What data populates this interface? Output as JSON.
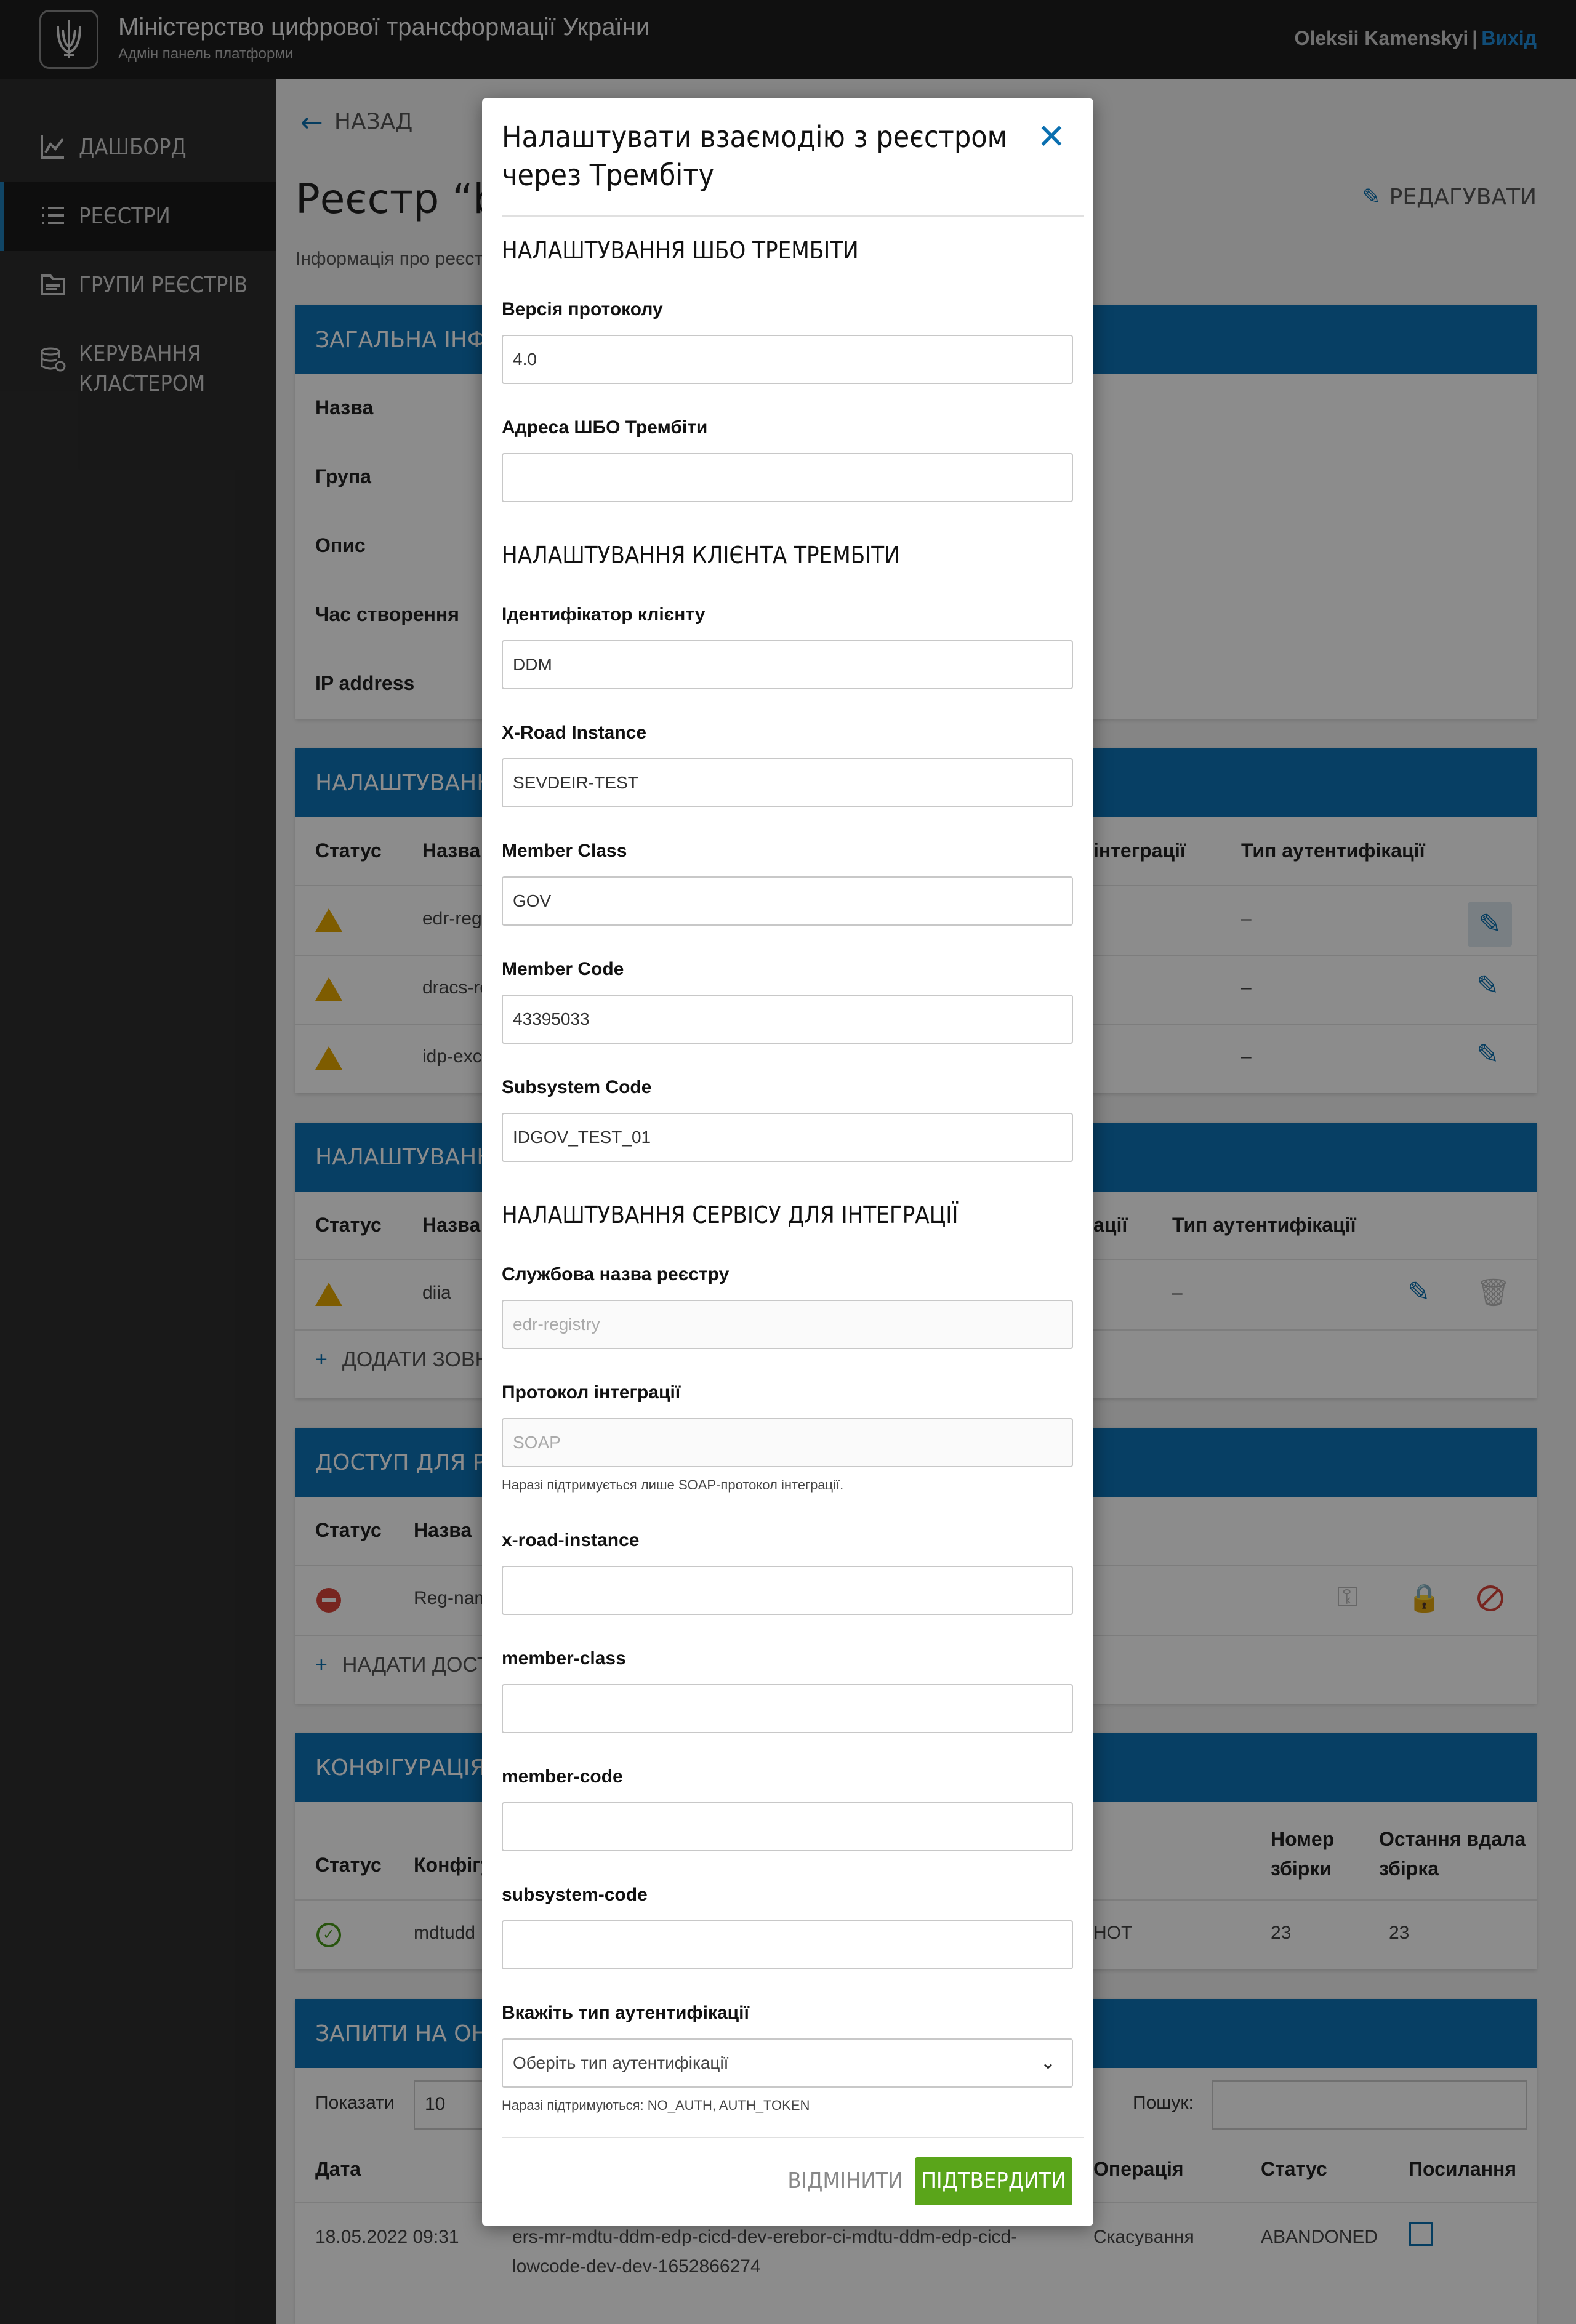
{
  "header": {
    "title": "Міністерство цифрової трансформації України",
    "subtitle": "Адмін панель платформи",
    "user_name": "Oleksii Kamenskyi",
    "separator": "|",
    "logout": "Вихід"
  },
  "sidebar": {
    "items": [
      {
        "label": "Дашборд",
        "icon": "chart-icon"
      },
      {
        "label": "Реєстри",
        "icon": "list-icon",
        "active": true
      },
      {
        "label": "Групи реєстрів",
        "icon": "folder-icon"
      },
      {
        "label": "Керування кластером",
        "icon": "database-gear-icon"
      }
    ]
  },
  "page": {
    "back": "Назад",
    "title": "Реєстр “busi",
    "subtitle": "Інформація про реєстр",
    "edit": "Редагувати",
    "general": {
      "header": "Загальна інформа",
      "rows": [
        "Назва",
        "Група",
        "Опис",
        "Час створення",
        "IP address"
      ]
    },
    "integration": {
      "header": "Налаштування вз",
      "col_status": "Статус",
      "col_name": "Назва",
      "col_integration": "інтеграції",
      "col_auth": "Тип аутентифікації",
      "rows": [
        {
          "name": "edr-reg",
          "auth": "–"
        },
        {
          "name": "dracs-re",
          "auth": "–"
        },
        {
          "name": "idp-exc",
          "auth": "–"
        }
      ]
    },
    "external": {
      "header": "Налаштування вз",
      "col_status": "Статус",
      "col_name": "Назва",
      "col_integration": "ації",
      "col_auth": "Тип аутентифікації",
      "row_name": "diia",
      "row_auth": "–",
      "add": "Додати зовн"
    },
    "access": {
      "header": "Доступ для реєст",
      "col_status": "Статус",
      "col_name": "Назва",
      "row_name": "Reg-nam",
      "add": "Надати дост"
    },
    "config": {
      "header": "Конфігурація",
      "col_status": "Статус",
      "col_config": "Конфігу",
      "col_build": "Номер збірки",
      "col_last": "Остання вдала збірка",
      "row_name": "mdtudd",
      "row_branch": "HOT",
      "row_build": "23",
      "row_last": "23"
    },
    "requests": {
      "header": "Запити на оновле",
      "show_label": "Показати",
      "show_value": "10",
      "search_label": "Пошук:",
      "col_date": "Дата",
      "col_op": "Операція",
      "col_status": "Статус",
      "col_link": "Посилання",
      "row_date": "18.05.2022 09:31",
      "row_name_1": "ers-mr-mdtu-ddm-edp-cicd-dev-erebor-ci-mdtu-ddm-edp-cicd-",
      "row_name_2": "lowcode-dev-dev-1652866274",
      "row_op": "Скасування",
      "row_status": "ABANDONED"
    }
  },
  "modal": {
    "title": "Налаштувати взаємодію з реєстром через Трембіту",
    "section1": "Налаштування ШБО Трембіти",
    "protocol_label": "Версія протоколу",
    "protocol_value": "4.0",
    "address_label": "Адреса ШБО Трембіти",
    "address_value": "",
    "section2": "Налаштування клієнта Трембіти",
    "client_id_label": "Ідентифікатор клієнту",
    "client_id_value": "DDM",
    "xroad_label": "X-Road Instance",
    "xroad_value": "SEVDEIR-TEST",
    "member_class_label": "Member Class",
    "member_class_value": "GOV",
    "member_code_label": "Member Code",
    "member_code_value": "43395033",
    "subsystem_label": "Subsystem Code",
    "subsystem_value": "IDGOV_TEST_01",
    "section3": "Налаштування сервісу для інтеграції",
    "service_name_label": "Службова назва реєстру",
    "service_name_value": "edr-registry",
    "int_protocol_label": "Протокол інтеграції",
    "int_protocol_value": "SOAP",
    "int_protocol_hint": "Наразі підтримується лише SOAP-протокол інтеграції.",
    "svc_xroad_label": "x-road-instance",
    "svc_member_class_label": "member-class",
    "svc_member_code_label": "member-code",
    "svc_subsystem_label": "subsystem-code",
    "auth_label": "Вкажіть тип аутентифікації",
    "auth_placeholder": "Оберіть тип аутентифікації",
    "auth_hint": "Наразі підтримуються: NO_AUTH, AUTH_TOKEN",
    "cancel": "Відмінити",
    "confirm": "Підтвердити"
  },
  "colors": {
    "accent": "#0d73b6",
    "confirm": "#5aa51a",
    "warning": "#e6a800",
    "error": "#d9443a",
    "success": "#4a9a1a"
  }
}
